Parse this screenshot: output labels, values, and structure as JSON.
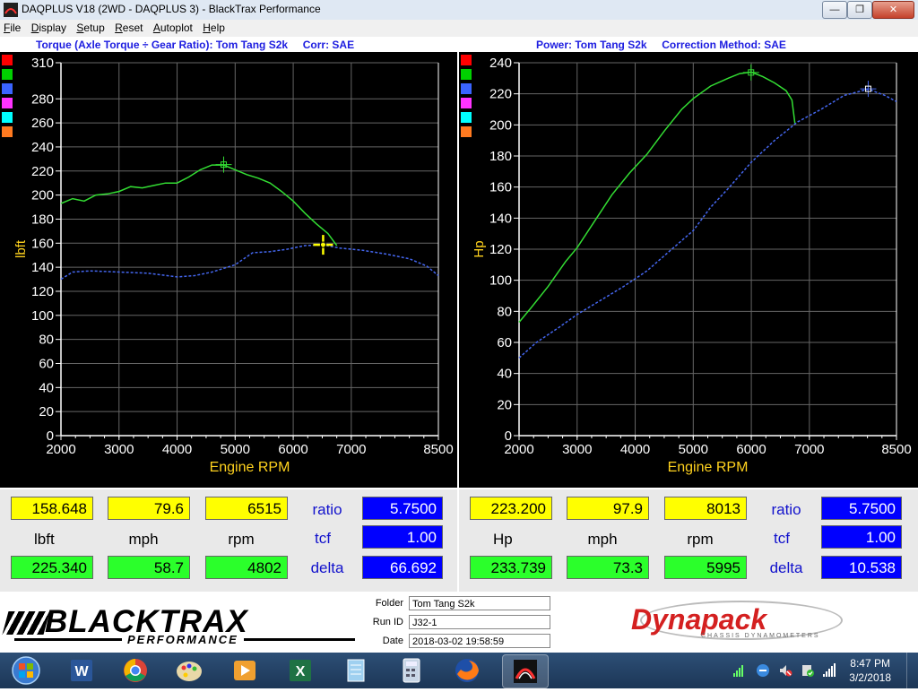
{
  "window": {
    "title": "DAQPLUS V18 (2WD - DAQPLUS 3) - BlackTrax Performance",
    "minimize": "—",
    "restore": "❐",
    "close": "✕"
  },
  "menu": [
    {
      "label": "File",
      "key": "F",
      "rest": "ile"
    },
    {
      "label": "Display",
      "key": "D",
      "rest": "isplay"
    },
    {
      "label": "Setup",
      "key": "S",
      "rest": "etup"
    },
    {
      "label": "Reset",
      "key": "R",
      "rest": "eset"
    },
    {
      "label": "Autoplot",
      "key": "A",
      "rest": "utoplot"
    },
    {
      "label": "Help",
      "key": "H",
      "rest": "elp"
    }
  ],
  "colors": {
    "green": "#33dd33",
    "blue": "#4466ee",
    "axis": "#ffffff",
    "grid": "#666666",
    "label": "#ffd21e",
    "titleText": "#1d1de0"
  },
  "swatches": [
    "#ff0000",
    "#00d000",
    "#3a64ff",
    "#ff33ff",
    "#00ffff",
    "#ff7a20"
  ],
  "torque": {
    "title": "Torque (Axle Torque ÷ Gear Ratio): Tom Tang S2k     Corr: SAE",
    "ylabel": "lbft",
    "xlabel": "Engine RPM"
  },
  "power": {
    "title": "Power: Tom Tang S2k     Correction Method: SAE",
    "ylabel": "Hp",
    "xlabel": "Engine RPM"
  },
  "chart_data": [
    {
      "type": "line",
      "title": "Torque (Axle Torque ÷ Gear Ratio): Tom Tang S2k     Corr: SAE",
      "xlabel": "Engine RPM",
      "ylabel": "lbft",
      "xlim": [
        2000,
        8500
      ],
      "ylim": [
        0,
        310
      ],
      "xticks": [
        2000,
        3000,
        4000,
        5000,
        6000,
        7000,
        8500
      ],
      "yticks": [
        0,
        20,
        40,
        60,
        80,
        100,
        120,
        140,
        160,
        180,
        200,
        220,
        240,
        260,
        280,
        310
      ],
      "grid": true,
      "series": [
        {
          "color": "#33dd33",
          "style": "solid",
          "x": [
            2000,
            2200,
            2400,
            2600,
            2800,
            3000,
            3200,
            3400,
            3600,
            3800,
            4000,
            4200,
            4400,
            4600,
            4800,
            5000,
            5200,
            5400,
            5600,
            5800,
            6000,
            6200,
            6400,
            6600,
            6750
          ],
          "y": [
            193,
            197,
            195,
            200,
            201,
            203,
            207,
            206,
            208,
            210,
            210,
            215,
            221,
            225,
            225,
            221,
            217,
            214,
            210,
            203,
            195,
            185,
            176,
            168,
            158
          ]
        },
        {
          "color": "#4466ee",
          "style": "dashed",
          "x": [
            2000,
            2200,
            2500,
            3000,
            3500,
            4000,
            4300,
            4600,
            5000,
            5300,
            5600,
            5900,
            6200,
            6515,
            6800,
            7200,
            7600,
            8000,
            8300,
            8500
          ],
          "y": [
            130,
            136,
            137,
            136,
            135,
            132,
            133,
            136,
            142,
            152,
            153,
            155,
            158,
            158.6,
            156,
            154,
            151,
            147,
            141,
            133
          ]
        }
      ],
      "markers": [
        {
          "x": 4802,
          "y": 225.34,
          "series": 0
        },
        {
          "x": 6515,
          "y": 158.648,
          "series": 1
        }
      ]
    },
    {
      "type": "line",
      "title": "Power: Tom Tang S2k     Correction Method: SAE",
      "xlabel": "Engine RPM",
      "ylabel": "Hp",
      "xlim": [
        2000,
        8500
      ],
      "ylim": [
        0,
        240
      ],
      "xticks": [
        2000,
        3000,
        4000,
        5000,
        6000,
        7000,
        8500
      ],
      "yticks": [
        0,
        20,
        40,
        60,
        80,
        100,
        120,
        140,
        160,
        180,
        200,
        220,
        240
      ],
      "grid": true,
      "series": [
        {
          "color": "#33dd33",
          "style": "solid",
          "x": [
            2000,
            2200,
            2500,
            2800,
            3000,
            3300,
            3600,
            3900,
            4200,
            4500,
            4800,
            5000,
            5300,
            5600,
            5800,
            6000,
            6200,
            6400,
            6600,
            6700,
            6750
          ],
          "y": [
            73,
            82,
            96,
            112,
            121,
            138,
            155,
            169,
            181,
            196,
            210,
            217,
            225,
            230,
            233,
            234,
            231,
            227,
            222,
            216,
            201
          ]
        },
        {
          "color": "#4466ee",
          "style": "dashed",
          "x": [
            2000,
            2300,
            2700,
            3000,
            3400,
            3800,
            4200,
            4600,
            5000,
            5300,
            5600,
            6000,
            6400,
            6800,
            7200,
            7600,
            8013,
            8300,
            8500
          ],
          "y": [
            50,
            60,
            70,
            78,
            87,
            96,
            106,
            119,
            132,
            147,
            159,
            176,
            190,
            202,
            210,
            219,
            223,
            219,
            215
          ]
        }
      ],
      "markers": [
        {
          "x": 5995,
          "y": 233.739,
          "series": 0
        },
        {
          "x": 8013,
          "y": 223.2,
          "series": 1
        }
      ]
    }
  ],
  "readout_left": {
    "cursor_value": "158.648",
    "cursor_speed": "79.6",
    "cursor_rpm": "6515",
    "unit": "lbft",
    "speed_unit": "mph",
    "rpm_unit": "rpm",
    "peak_value": "225.340",
    "peak_speed": "58.7",
    "peak_rpm": "4802",
    "ratio_label": "ratio",
    "ratio": "5.7500",
    "tcf_label": "tcf",
    "tcf": "1.00",
    "delta_label": "delta",
    "delta": "66.692"
  },
  "readout_right": {
    "cursor_value": "223.200",
    "cursor_speed": "97.9",
    "cursor_rpm": "8013",
    "unit": "Hp",
    "speed_unit": "mph",
    "rpm_unit": "rpm",
    "peak_value": "233.739",
    "peak_speed": "73.3",
    "peak_rpm": "5995",
    "ratio_label": "ratio",
    "ratio": "5.7500",
    "tcf_label": "tcf",
    "tcf": "1.00",
    "delta_label": "delta",
    "delta": "10.538"
  },
  "footer": {
    "brand": "BLACKTRAX",
    "brand_sub": "PERFORMANCE",
    "folder_label": "Folder",
    "folder": "Tom Tang S2k",
    "runid_label": "Run ID",
    "runid": "J32-1",
    "date_label": "Date",
    "date": "2018-03-02 19:58:59",
    "dynapack": "Dynapack",
    "dynapack_sub": "CHASSIS DYNAMOMETERS"
  },
  "taskbar": {
    "time": "8:47 PM",
    "date": "3/2/2018",
    "icons": [
      "start-orb-icon",
      "word-icon",
      "chrome-icon",
      "paint-icon",
      "media-player-icon",
      "excel-icon",
      "notepad-icon",
      "calculator-icon",
      "firefox-icon",
      "daqplus-icon"
    ]
  }
}
